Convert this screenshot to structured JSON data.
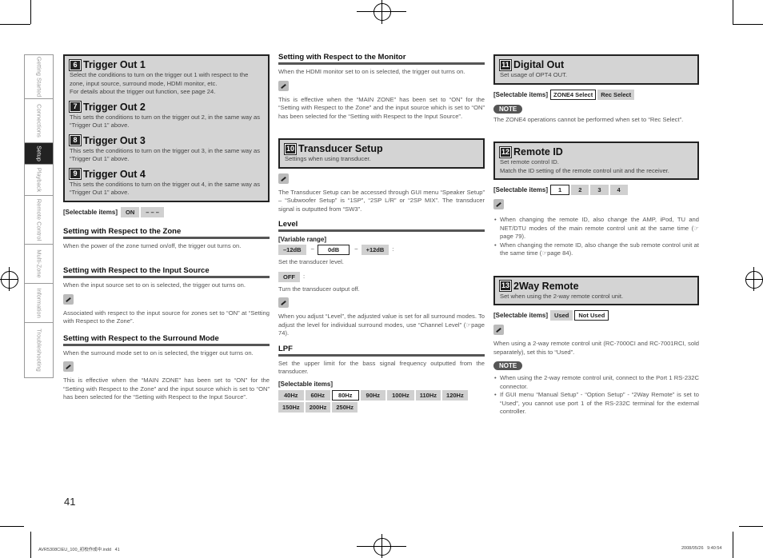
{
  "side_tabs": [
    "Getting Started",
    "Connections",
    "Setup",
    "Playback",
    "Remote Control",
    "Multi-Zone",
    "Information",
    "Troubleshooting"
  ],
  "active_tab": "Setup",
  "page_number": "41",
  "footer": {
    "file": "AVR5308CIEU_100_初校作成中.indd   41",
    "timestamp": "2008/05/26   9:40:54"
  },
  "left": {
    "box": [
      {
        "num": "6",
        "title": "Trigger Out 1",
        "desc": "Select the conditions to turn on the trigger out 1 with respect to the zone, input source, surround mode, HDMI monitor, etc.",
        "desc2": "For details about the trigger out function, see page 24."
      },
      {
        "num": "7",
        "title": "Trigger Out 2",
        "desc": "This sets the conditions to turn on the trigger out 2, in the same way as “Trigger Out 1” above."
      },
      {
        "num": "8",
        "title": "Trigger Out 3",
        "desc": "This sets the conditions to turn on the trigger out 3, in the same way as “Trigger Out 1” above."
      },
      {
        "num": "9",
        "title": "Trigger Out 4",
        "desc": "This sets the conditions to turn on the trigger out 4, in the same way as “Trigger Out 1” above."
      }
    ],
    "selectable_label": "[Selectable items]",
    "selectable": [
      "ON",
      "– – –"
    ],
    "zone_title": "Setting with Respect to the Zone",
    "zone_text": "When the power of the zone turned on/off, the trigger out turns on.",
    "input_title": "Setting with Respect to the Input Source",
    "input_text": "When the input source set to on is selected, the trigger out turns on.",
    "input_note": "Associated with respect to the input source for zones set to “ON” at “Setting with Respect to the Zone”.",
    "surround_title": "Setting with Respect to the Surround Mode",
    "surround_text": "When the surround mode set to on is selected, the trigger out turns on.",
    "surround_note": "This is effective when the “MAIN ZONE” has been set to “ON” for the “Setting with Respect to the Zone” and the input source which is set to “ON” has been selected for the “Setting with Respect to the Input Source”."
  },
  "middle": {
    "monitor_title": "Setting with Respect to the Monitor",
    "monitor_text": "When the HDMI monitor set to on is selected, the trigger out turns on.",
    "monitor_note": "This is effective when the “MAIN ZONE” has been set to “ON” for the “Setting with Respect to the Zone” and the input source which is set to “ON” has been selected for the “Setting with Respect to the Input Source”.",
    "transducer": {
      "num": "10",
      "title": "Transducer Setup",
      "desc": "Settings when using transducer."
    },
    "transducer_note": "The Transducer Setup can be accessed through GUI menu “Speaker Setup” – “Subwoofer Setup” is “1SP”, “2SP L/R” or “2SP MIX”. The transducer signal is outputted from “SW3”.",
    "level_title": "Level",
    "variable_label": "[Variable range]",
    "range": [
      "–12dB",
      "0dB",
      "+12dB"
    ],
    "range_sep": "~",
    "colon": ":",
    "level_text": "Set the transducer level.",
    "off_label": "OFF",
    "off_text": "Turn the transducer output off.",
    "level_note": "When you adjust “Level”, the adjusted value is set for all surround modes. To adjust the level for individual surround modes, use “Channel Level” (☞page 74).",
    "lpf_title": "LPF",
    "lpf_text": "Set the upper limit for the bass signal frequency outputted from the transducer.",
    "selectable_label": "[Selectable items]",
    "lpf_row1": [
      "40Hz",
      "60Hz",
      "80Hz",
      "90Hz",
      "100Hz",
      "110Hz",
      "120Hz"
    ],
    "lpf_row2": [
      "150Hz",
      "200Hz",
      "250Hz"
    ],
    "lpf_selected": "80Hz"
  },
  "right": {
    "digital": {
      "num": "11",
      "title": "Digital Out",
      "desc": "Set usage of OPT4 OUT."
    },
    "selectable_label": "[Selectable items]",
    "digital_items": [
      "ZONE4 Select",
      "Rec Select"
    ],
    "digital_selected": "ZONE4 Select",
    "note_label": "NOTE",
    "digital_note": "The ZONE4 operations cannot be performed when set to “Rec Select”.",
    "remote": {
      "num": "12",
      "title": "Remote ID",
      "desc": "Set remote control ID.",
      "desc2": "Match the ID setting of the remote control unit and the receiver."
    },
    "remote_items": [
      "1",
      "2",
      "3",
      "4"
    ],
    "remote_selected": "1",
    "remote_notes": [
      "When changing the remote ID, also change the AMP, iPod, TU and NET/DTU modes of the main remote control unit at the same time (☞page 79).",
      "When changing the remote ID, also change the sub remote control unit at the same time (☞page 84)."
    ],
    "twoway": {
      "num": "13",
      "title": "2Way Remote",
      "desc": "Set when using the 2-way remote control unit."
    },
    "twoway_items": [
      "Used",
      "Not Used"
    ],
    "twoway_selected": "Not Used",
    "twoway_note": "When using a 2-way remote control unit (RC-7000CI and RC-7001RCI, sold separately), set this to “Used”.",
    "twoway_notes": [
      "When using the 2-way remote control unit, connect to the Port 1 RS-232C connector.",
      "If GUI menu “Manual Setup” - “Option Setup” - “2Way Remote” is set to “Used”, you cannot use port 1 of the RS-232C terminal for the external controller."
    ]
  }
}
